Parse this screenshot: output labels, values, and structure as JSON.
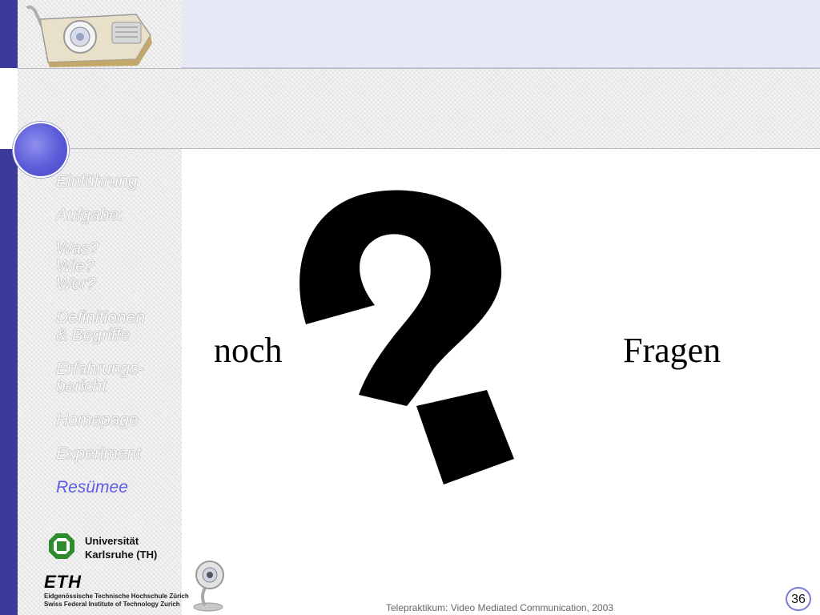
{
  "sidebar": {
    "items": [
      {
        "label": "Einführung",
        "active": false
      },
      {
        "label": "Aufgabe:",
        "active": false
      },
      {
        "label": "Was?\nWie?\nWer?",
        "active": false
      },
      {
        "label": "Definitionen\n& Begriffe",
        "active": false
      },
      {
        "label": "Erfahrungs-\nbericht",
        "active": false
      },
      {
        "label": "Homepage",
        "active": false
      },
      {
        "label": "Experiment",
        "active": false
      },
      {
        "label": "Resümee",
        "active": true
      }
    ]
  },
  "logos": {
    "university": "Universität\nKarlsruhe (TH)",
    "eth_mark": "ETH",
    "eth_line1": "Eidgenössische Technische Hochschule Zürich",
    "eth_line2": "Swiss Federal Institute of Technology Zurich"
  },
  "main": {
    "word_left": "noch",
    "word_right": "Fragen"
  },
  "footer": {
    "caption": "Telepraktikum: Video Mediated Communication, 2003",
    "page_number": "36"
  },
  "colors": {
    "sidebar_bar": "#3a3a9a",
    "active_nav": "#5b5be8",
    "badge_border": "#7a7ad8"
  }
}
